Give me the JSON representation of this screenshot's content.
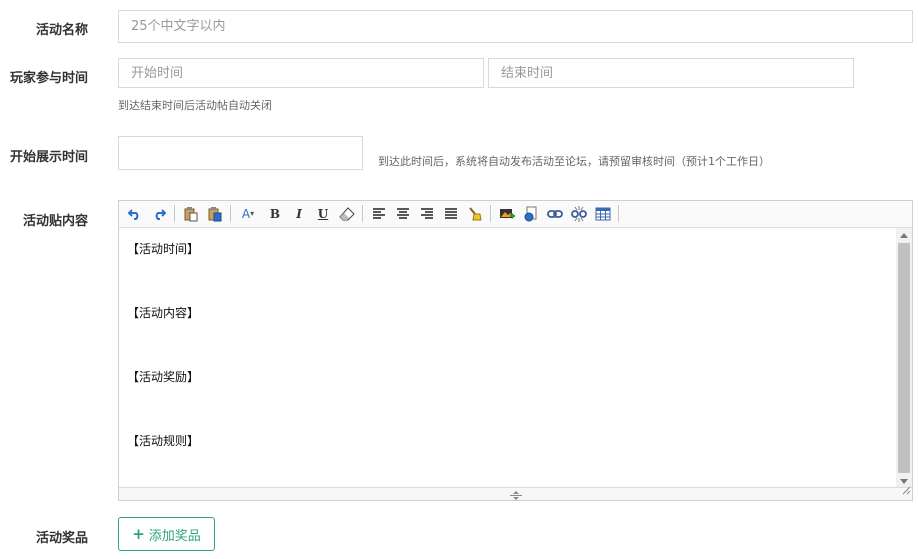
{
  "form": {
    "activity_name": {
      "label": "活动名称",
      "placeholder": "25个中文字以内"
    },
    "player_time": {
      "label": "玩家参与时间",
      "start_placeholder": "开始时间",
      "end_placeholder": "结束时间",
      "hint": "到达结束时间后活动帖自动关闭"
    },
    "display_time": {
      "label": "开始展示时间",
      "hint": "到达此时间后，系统将自动发布活动至论坛，请预留审核时间（预计1个工作日）"
    },
    "post_content": {
      "label": "活动贴内容",
      "paragraphs": [
        "【活动时间】",
        "【活动内容】",
        "【活动奖励】",
        "【活动规则】"
      ]
    },
    "prizes": {
      "label": "活动奖品",
      "add_button": "添加奖品"
    }
  },
  "toolbar": {
    "font_color_glyph": "A",
    "bold_glyph": "B",
    "italic_glyph": "I",
    "underline_glyph": "U"
  },
  "colors": {
    "accent": "#2fa37a",
    "toolbar_blue": "#2a6fc9",
    "border": "#d9d9d9"
  }
}
